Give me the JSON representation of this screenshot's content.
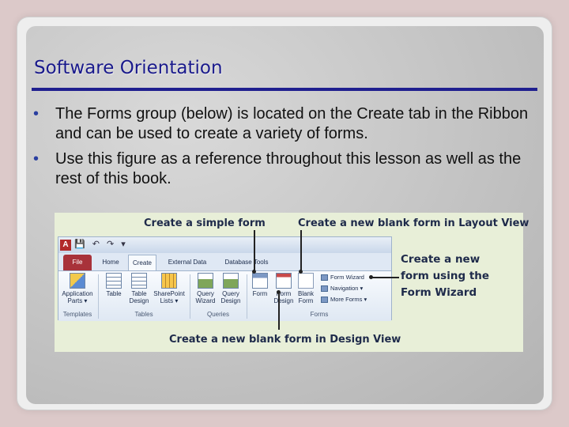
{
  "slide": {
    "title": "Software Orientation",
    "bullets": [
      "The Forms group (below) is located on the Create tab in the Ribbon and can be used to create a variety of forms.",
      "Use this figure as a reference throughout this lesson as well as the rest of this book."
    ],
    "bullet_glyph": "•"
  },
  "figure": {
    "callouts": {
      "simple_form": "Create a simple form",
      "blank_layout": "Create a new blank form in Layout View",
      "wizard_line1": "Create a new",
      "wizard_line2": "form using the",
      "wizard_line3": "Form Wizard",
      "blank_design": "Create a new blank form in Design View"
    },
    "ribbon": {
      "app_icon": "A",
      "qat": "💾 ↶ ↷ ▾",
      "tabs": [
        "File",
        "Home",
        "Create",
        "External Data",
        "Database Tools"
      ],
      "buttons": {
        "application_parts": [
          "Application",
          "Parts ▾"
        ],
        "table": "Table",
        "table_design": [
          "Table",
          "Design"
        ],
        "sharepoint_lists": [
          "SharePoint",
          "Lists ▾"
        ],
        "query_wizard": [
          "Query",
          "Wizard"
        ],
        "query_design": [
          "Query",
          "Design"
        ],
        "form": "Form",
        "form_design": [
          "Form",
          "Design"
        ],
        "blank_form": [
          "Blank",
          "Form"
        ],
        "form_wizard": "Form Wizard",
        "navigation": "Navigation ▾",
        "more_forms": "More Forms ▾"
      },
      "groups": [
        "Templates",
        "Tables",
        "Queries",
        "Forms"
      ]
    }
  },
  "colors": {
    "title": "#1a1a8c",
    "rule": "#1f1f8f",
    "figure_bg": "#e8efd8",
    "file_tab": "#a8323a"
  }
}
